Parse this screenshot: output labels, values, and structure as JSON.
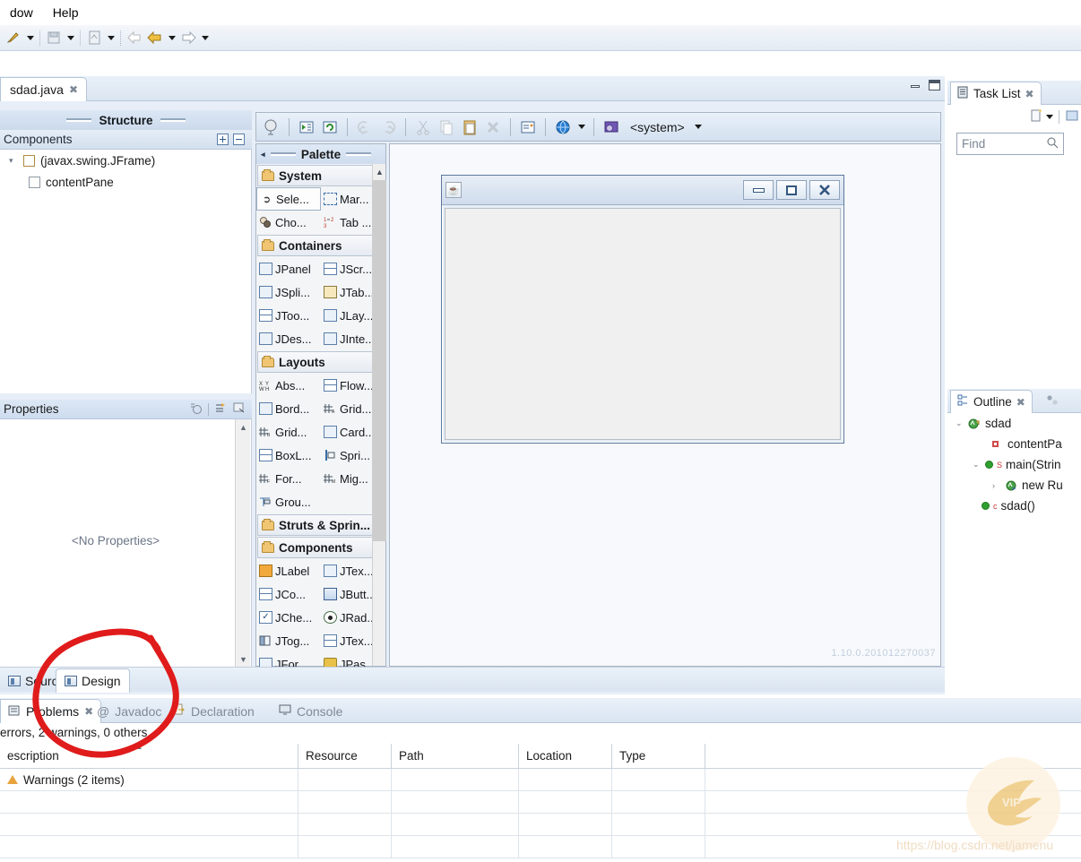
{
  "menubar": {
    "items": [
      "dow",
      "Help"
    ]
  },
  "toolbar": {
    "buttons": [
      "new-wizard",
      "save",
      "open-type",
      "back",
      "forward"
    ]
  },
  "editor": {
    "tab_label": "sdad.java",
    "tab_close": "✖",
    "minimize_title": "Minimize",
    "maximize_title": "Maximize"
  },
  "structure": {
    "title": "Structure",
    "components_label": "Components",
    "expand_all": "Expand All",
    "collapse_all": "Collapse All",
    "tree": [
      {
        "label": "(javax.swing.JFrame)",
        "indent": 0,
        "twisty": "▾"
      },
      {
        "label": "contentPane",
        "indent": 1,
        "twisty": ""
      }
    ]
  },
  "properties": {
    "title": "Properties",
    "empty_text": "<No Properties>"
  },
  "palette": {
    "title": "Palette",
    "collapse_icon": "◂",
    "groups": [
      {
        "name": "System",
        "items": [
          {
            "label": "Sele...",
            "icon": "cursor-icon",
            "selected": true
          },
          {
            "label": "Mar...",
            "icon": "marquee-icon",
            "selected": false
          },
          {
            "label": "Cho...",
            "icon": "choose-component-icon",
            "selected": false
          },
          {
            "label": "Tab ...",
            "icon": "tab-order-icon",
            "selected": false
          }
        ]
      },
      {
        "name": "Containers",
        "items": [
          {
            "label": "JPanel",
            "icon": "jpanel-icon",
            "selected": false
          },
          {
            "label": "JScr...",
            "icon": "jscrollpane-icon",
            "selected": false
          },
          {
            "label": "JSpli...",
            "icon": "jsplitpane-icon",
            "selected": false
          },
          {
            "label": "JTab...",
            "icon": "jtabbedpane-icon",
            "selected": false
          },
          {
            "label": "JToo...",
            "icon": "jtoolbar-icon",
            "selected": false
          },
          {
            "label": "JLay...",
            "icon": "jlayeredpane-icon",
            "selected": false
          },
          {
            "label": "JDes...",
            "icon": "jdesktoppane-icon",
            "selected": false
          },
          {
            "label": "JInte...",
            "icon": "jinternalframe-icon",
            "selected": false
          }
        ]
      },
      {
        "name": "Layouts",
        "items": [
          {
            "label": "Abs...",
            "icon": "absolute-layout-icon",
            "selected": false
          },
          {
            "label": "Flow...",
            "icon": "flow-layout-icon",
            "selected": false
          },
          {
            "label": "Bord...",
            "icon": "border-layout-icon",
            "selected": false
          },
          {
            "label": "Grid...",
            "icon": "gridbag-layout-icon",
            "selected": false
          },
          {
            "label": "Grid...",
            "icon": "grid-layout-icon",
            "selected": false
          },
          {
            "label": "Card...",
            "icon": "card-layout-icon",
            "selected": false
          },
          {
            "label": "BoxL...",
            "icon": "box-layout-icon",
            "selected": false
          },
          {
            "label": "Spri...",
            "icon": "spring-layout-icon",
            "selected": false
          },
          {
            "label": "For...",
            "icon": "form-layout-icon",
            "selected": false
          },
          {
            "label": "Mig...",
            "icon": "mig-layout-icon",
            "selected": false
          },
          {
            "label": "Grou...",
            "icon": "group-layout-icon",
            "selected": false
          }
        ]
      },
      {
        "name": "Struts & Sprin...",
        "items": []
      },
      {
        "name": "Components",
        "items": [
          {
            "label": "JLabel",
            "icon": "jlabel-icon",
            "selected": false
          },
          {
            "label": "JTex...",
            "icon": "jtextfield-icon",
            "selected": false
          },
          {
            "label": "JCo...",
            "icon": "jcombobox-icon",
            "selected": false
          },
          {
            "label": "JButt...",
            "icon": "jbutton-icon",
            "selected": false
          },
          {
            "label": "JChe...",
            "icon": "jcheckbox-icon",
            "selected": false
          },
          {
            "label": "JRad...",
            "icon": "jradiobutton-icon",
            "selected": false
          },
          {
            "label": "JTog...",
            "icon": "jtogglebutton-icon",
            "selected": false
          },
          {
            "label": "JTex...",
            "icon": "jtextarea-icon",
            "selected": false
          },
          {
            "label": "JFor...",
            "icon": "jformattedtextfield-icon",
            "selected": false
          },
          {
            "label": "JPas...",
            "icon": "jpasswordfield-icon",
            "selected": false
          }
        ]
      }
    ]
  },
  "design_toolbar": {
    "system_label": "<system>",
    "buttons": [
      "test-icon",
      "refresh-parser-icon",
      "refresh-icon",
      "undo-icon",
      "redo-icon",
      "cut-icon",
      "copy-icon",
      "paste-icon",
      "delete-icon",
      "properties-icon",
      "preview-icon",
      "look-and-feel-icon"
    ]
  },
  "canvas": {
    "frame_title": "",
    "version_text": "1.10.0.201012270037",
    "minimize_label": "Minimize",
    "maximize_label": "Maximize",
    "close_label": "Close"
  },
  "task_list": {
    "title": "Task List",
    "close": "✖",
    "find_placeholder": "Find",
    "new_task_label": "New Task",
    "menu_label": "View Menu"
  },
  "outline": {
    "title": "Outline",
    "close": "✖",
    "rows": [
      {
        "label": "sdad",
        "indent": 0,
        "twisty": "⌄",
        "icon": "class-icon"
      },
      {
        "label": "contentPa",
        "indent": 2,
        "twisty": "",
        "icon": "field-icon"
      },
      {
        "label": "main(Strin",
        "indent": 1,
        "twisty": "⌄",
        "icon": "method-icon",
        "modifier": "S"
      },
      {
        "label": "new Ru",
        "indent": 2,
        "twisty": "›",
        "icon": "anonymous-class-icon"
      },
      {
        "label": "sdad()",
        "indent": 1,
        "twisty": "",
        "icon": "constructor-icon",
        "modifier": "c"
      }
    ]
  },
  "source_design": {
    "tabs": [
      {
        "label": "Source",
        "active": false,
        "icon": "source-icon"
      },
      {
        "label": "Design",
        "active": true,
        "icon": "design-icon"
      }
    ]
  },
  "problems": {
    "tabs": [
      {
        "label": "Problems",
        "active": true,
        "icon": "problems-icon",
        "close": "✖"
      },
      {
        "label": "Javadoc",
        "active": false,
        "icon": "javadoc-icon"
      },
      {
        "label": "Declaration",
        "active": false,
        "icon": "declaration-icon"
      },
      {
        "label": "Console",
        "active": false,
        "icon": "console-icon"
      }
    ],
    "summary": "errors, 2 warnings, 0 others",
    "columns": [
      "escription",
      "Resource",
      "Path",
      "Location",
      "Type"
    ],
    "rows": [
      {
        "description": "Warnings (2 items)",
        "resource": "",
        "path": "",
        "location": "",
        "type": "",
        "severity": "warning"
      }
    ]
  },
  "watermark": {
    "badge_text": "VIP",
    "url": "https://blog.csdn.net/jamenu"
  },
  "colors": {
    "accent": "#3a6ea8",
    "panel_bg": "#e7eef7",
    "annotation_red": "#e01b1b",
    "warning": "#e8a33d"
  }
}
